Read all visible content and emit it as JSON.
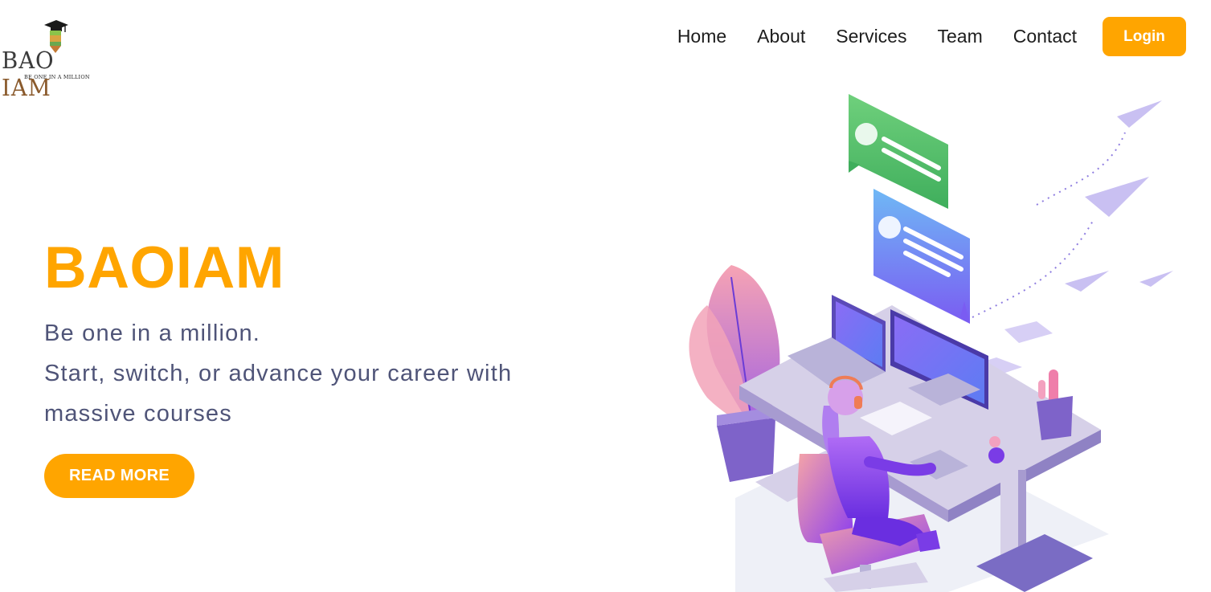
{
  "logo": {
    "word_part1": "BAO",
    "word_part2": "IAM",
    "tagline": "BE ONE IN A MILLION"
  },
  "nav": {
    "items": [
      "Home",
      "About",
      "Services",
      "Team",
      "Contact"
    ],
    "login_label": "Login"
  },
  "hero": {
    "title": "BAOIAM",
    "line1": "Be one in a million.",
    "line2": "Start, switch, or advance your career with massive courses",
    "cta_label": "READ MORE"
  },
  "colors": {
    "accent": "#ffa500",
    "subtitle": "#4f5478",
    "nav_text": "#1d1d1d"
  },
  "icons": {
    "logo_cap": "graduation-cap-icon",
    "logo_pencil": "pencil-icon"
  }
}
